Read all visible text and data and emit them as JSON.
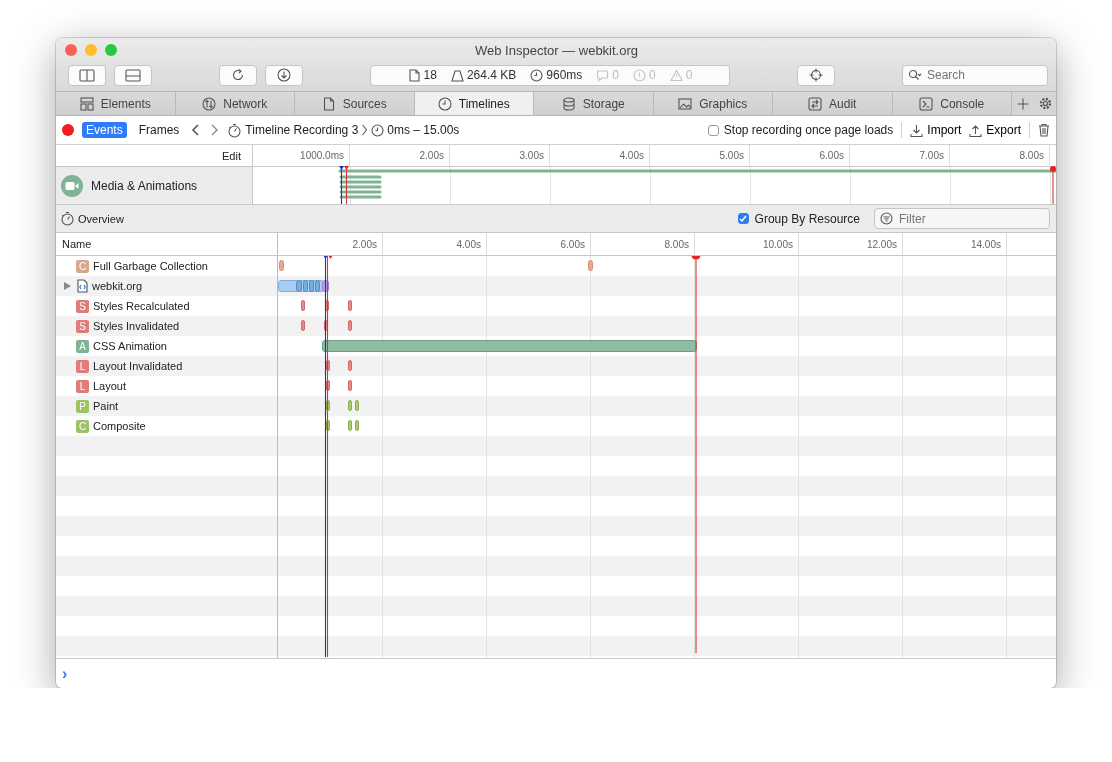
{
  "window": {
    "title": "Web Inspector — webkit.org"
  },
  "toolbar": {
    "dashboard": [
      {
        "kind": "resources",
        "text": "18",
        "disabled": false
      },
      {
        "kind": "size",
        "text": "264.4 KB",
        "disabled": false
      },
      {
        "kind": "time",
        "text": "960ms",
        "disabled": false
      },
      {
        "kind": "logs",
        "text": "0",
        "disabled": true
      },
      {
        "kind": "errors",
        "text": "0",
        "disabled": true
      },
      {
        "kind": "warnings",
        "text": "0",
        "disabled": true
      }
    ],
    "search": {
      "placeholder": "Search"
    }
  },
  "tabs": [
    {
      "label": "Elements",
      "selected": false
    },
    {
      "label": "Network",
      "selected": false
    },
    {
      "label": "Sources",
      "selected": false
    },
    {
      "label": "Timelines",
      "selected": true
    },
    {
      "label": "Storage",
      "selected": false
    },
    {
      "label": "Graphics",
      "selected": false
    },
    {
      "label": "Audit",
      "selected": false
    },
    {
      "label": "Console",
      "selected": false
    }
  ],
  "recording_bar": {
    "recording": true,
    "modes": [
      {
        "label": "Events",
        "selected": true
      },
      {
        "label": "Frames",
        "selected": false
      }
    ],
    "recording_name": "Timeline Recording 3",
    "range": "0ms – 15.00s",
    "stop_on_load": {
      "label": "Stop recording once page loads",
      "checked": false
    },
    "actions": [
      "Import",
      "Export"
    ]
  },
  "overview": {
    "edit_label": "Edit",
    "ticks": [
      "1000.0ms",
      "2.00s",
      "3.00s",
      "4.00s",
      "5.00s",
      "6.00s",
      "7.00s",
      "8.00s"
    ],
    "timelines": [
      {
        "name": "Media & Animations"
      }
    ]
  },
  "events_bar": {
    "title": "Overview",
    "group_by_resource": {
      "label": "Group By Resource",
      "checked": true
    },
    "filter": {
      "placeholder": "Filter"
    }
  },
  "table": {
    "name_column": "Name",
    "ticks": [
      "2.00s",
      "4.00s",
      "6.00s",
      "8.00s",
      "10.00s",
      "12.00s",
      "14.00s"
    ],
    "rows": [
      {
        "kind": "record",
        "badge": "C",
        "name": "Full Garbage Collection",
        "color": "#d6a98c"
      },
      {
        "kind": "resource",
        "name": "webkit.org",
        "expanded": false
      },
      {
        "kind": "record",
        "badge": "S",
        "name": "Styles Recalculated",
        "color": "#e07c7c"
      },
      {
        "kind": "record",
        "badge": "S",
        "name": "Styles Invalidated",
        "color": "#e07c7c"
      },
      {
        "kind": "record",
        "badge": "A",
        "name": "CSS Animation",
        "color": "#7fb394"
      },
      {
        "kind": "record",
        "badge": "L",
        "name": "Layout Invalidated",
        "color": "#e07c7c"
      },
      {
        "kind": "record",
        "badge": "L",
        "name": "Layout",
        "color": "#e07c7c"
      },
      {
        "kind": "record",
        "badge": "P",
        "name": "Paint",
        "color": "#9cc466"
      },
      {
        "kind": "record",
        "badge": "C",
        "name": "Composite",
        "color": "#9cc466"
      }
    ]
  },
  "console": {
    "prompt": "›"
  }
}
